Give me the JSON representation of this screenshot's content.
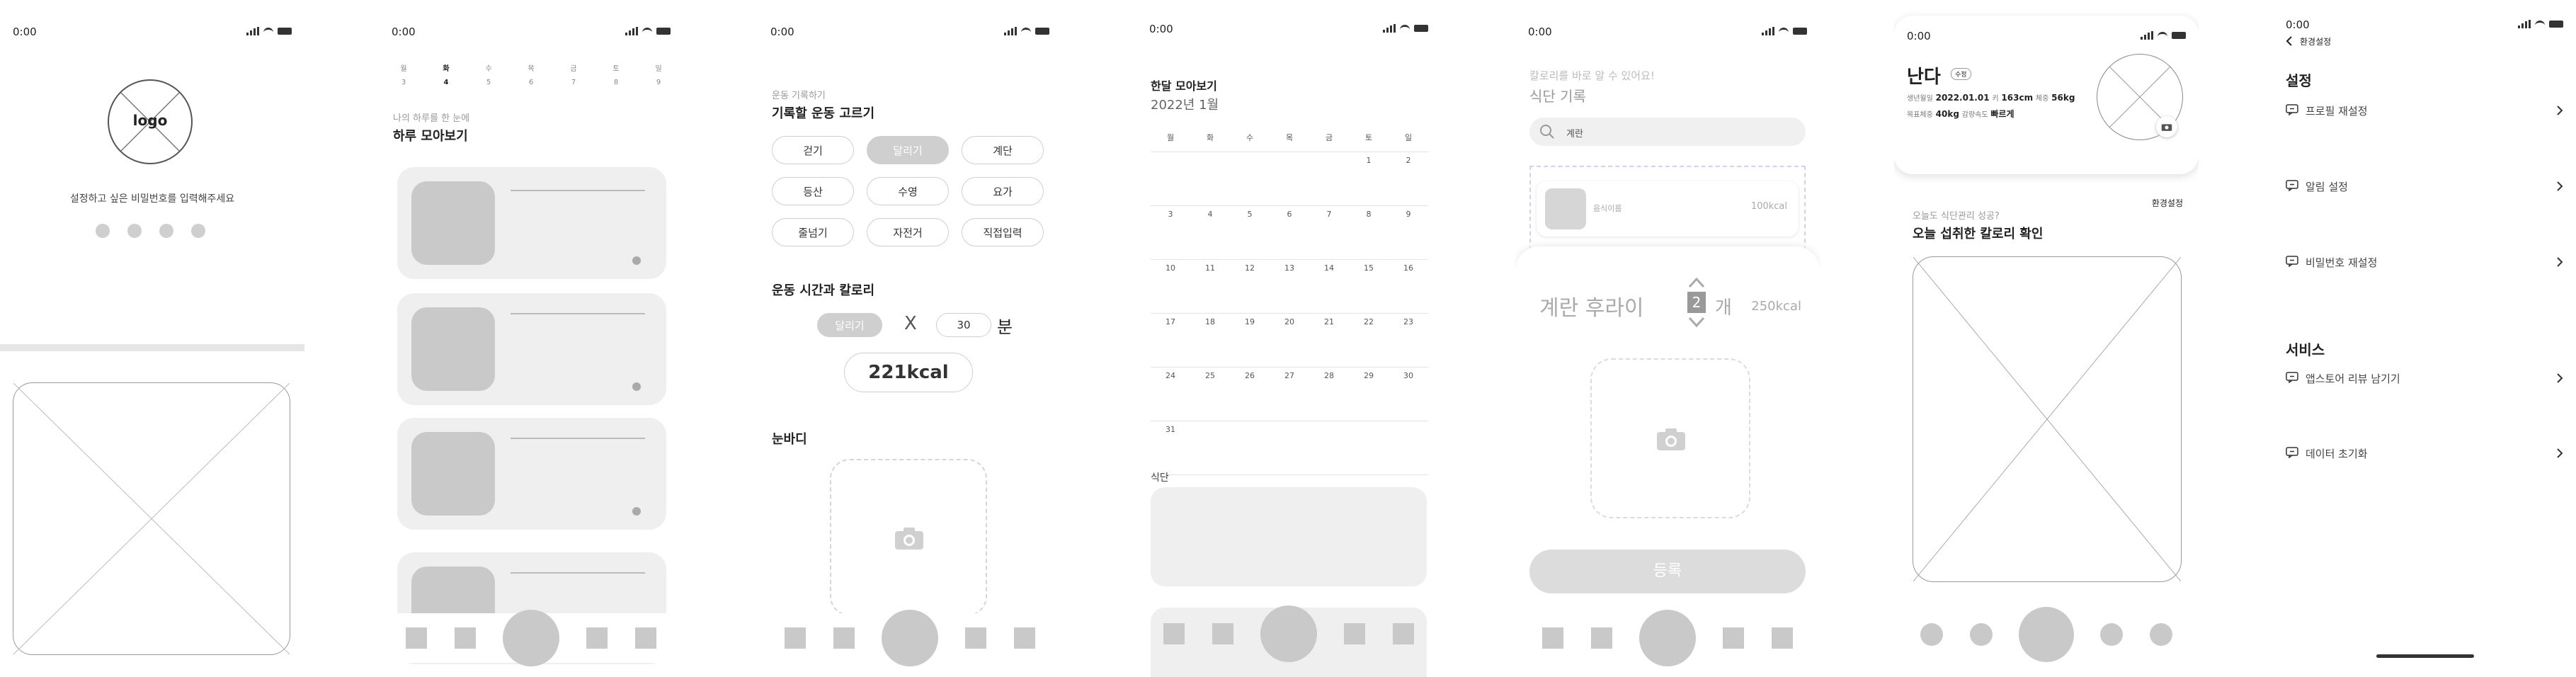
{
  "status": {
    "time": "0:00"
  },
  "screen1": {
    "logo": "logo",
    "prompt": "설정하고 싶은 비밀번호를 입력해주세요"
  },
  "screen2": {
    "week_days": [
      "월",
      "화",
      "수",
      "목",
      "금",
      "토",
      "일"
    ],
    "week_dates": [
      "3",
      "4",
      "5",
      "6",
      "7",
      "8",
      "9"
    ],
    "subtitle": "나의 하루를 한 눈에",
    "title": "하루 모아보기"
  },
  "screen3": {
    "subtitle": "운동 기록하기",
    "title": "기록할 운동 고르기",
    "exercises": [
      "걷기",
      "달리기",
      "계단",
      "등산",
      "수영",
      "요가",
      "줄넘기",
      "자전거",
      "직접입력"
    ],
    "selected": "달리기",
    "section_time": "운동 시간과 칼로리",
    "chosen": "달리기",
    "times": "X",
    "minutes": "30",
    "unit": "분",
    "kcal": "221kcal",
    "section_body": "눈바디"
  },
  "screen4": {
    "title": "한달 모아보기",
    "month": "2022년 1월",
    "weekdays": [
      "월",
      "화",
      "수",
      "목",
      "금",
      "토",
      "일"
    ],
    "weeks": [
      [
        "",
        "",
        "",
        "",
        "",
        "1",
        "2"
      ],
      [
        "3",
        "4",
        "5",
        "6",
        "7",
        "8",
        "9"
      ],
      [
        "10",
        "11",
        "12",
        "13",
        "14",
        "15",
        "16"
      ],
      [
        "17",
        "18",
        "19",
        "20",
        "21",
        "22",
        "23"
      ],
      [
        "24",
        "25",
        "26",
        "27",
        "28",
        "29",
        "30"
      ],
      [
        "31",
        "",
        "",
        "",
        "",
        "",
        ""
      ]
    ],
    "meal_label": "식단"
  },
  "screen5": {
    "subtitle": "칼로리를 바로 알 수 있어요!",
    "title": "식단 기록",
    "search_value": "계란",
    "item_name": "음식이름",
    "item_kcal": "100kcal",
    "food_name": "계란 후라이",
    "qty": "2",
    "qty_unit": "개",
    "food_kcal": "250kcal",
    "submit": "등록"
  },
  "screen6": {
    "name": "난다",
    "badge": "수정",
    "line1_label1": "생년월일",
    "birth": "2022.01.01",
    "line1_label2": "키",
    "height": "163cm",
    "line1_label3": "체중",
    "weight": "56kg",
    "line2_label1": "목표체중",
    "goal": "40kg",
    "line2_label2": "감량속도",
    "speed": "빠르게",
    "settings_link": "환경설정",
    "subtitle": "오늘도 식단관리 성공?",
    "title": "오늘 섭취한 칼로리 확인"
  },
  "screen7": {
    "back_label": "환경설정",
    "section1": "설정",
    "items1": [
      "프로필 재설정",
      "알림 설정",
      "비밀번호 재설정"
    ],
    "section2": "서비스",
    "items2": [
      "앱스토어 리뷰 남기기",
      "데이터 초기화"
    ]
  }
}
